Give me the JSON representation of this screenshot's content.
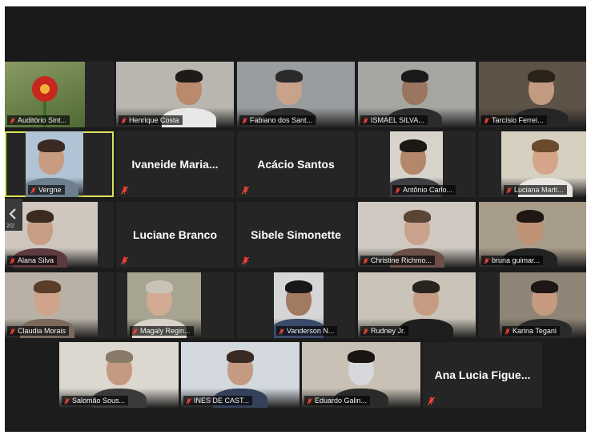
{
  "colors": {
    "background": "#1c1c1c",
    "tile": "#252525",
    "active_border": "#d9e25a",
    "muted_icon": "#e0352b",
    "name_text": "#f2f2f2"
  },
  "icons": {
    "muted": "microphone-muted-icon",
    "side": "chevron-left-icon"
  },
  "side_tab": {
    "label": "2/2"
  },
  "participants": [
    {
      "name": "Auditório Sint...",
      "video": true
    },
    {
      "name": "Henrique Costa",
      "video": true
    },
    {
      "name": "Fabiano dos Sant...",
      "video": true
    },
    {
      "name": "ISMAEL SILVA...",
      "video": true
    },
    {
      "name": "Tarcísio Ferrei...",
      "video": true
    },
    {
      "name": "Vergne",
      "video": true,
      "active_speaker": true
    },
    {
      "name": "Ivaneide Maria...",
      "video": false
    },
    {
      "name": "Acácio Santos",
      "video": false
    },
    {
      "name": "Antônio Carlo...",
      "video": true
    },
    {
      "name": "Luciana Marti...",
      "video": true
    },
    {
      "name": "Alana Silva",
      "video": true
    },
    {
      "name": "Luciane Branco",
      "video": false
    },
    {
      "name": "Sibele Simonette",
      "video": false
    },
    {
      "name": "Christine Richmo...",
      "video": true
    },
    {
      "name": "bruna guimar...",
      "video": true
    },
    {
      "name": "Claudia Morais",
      "video": true
    },
    {
      "name": "Magaly Regin...",
      "video": true
    },
    {
      "name": "Vanderson N...",
      "video": true
    },
    {
      "name": "Rudney Jr.",
      "video": true
    },
    {
      "name": "Karina Tegani",
      "video": true
    },
    {
      "name": "Salomão Sous...",
      "video": true
    },
    {
      "name": "INES DE CAST...",
      "video": true
    },
    {
      "name": "Eduardo Galin...",
      "video": true
    },
    {
      "name": "Ana Lucia Figue...",
      "video": false
    }
  ]
}
